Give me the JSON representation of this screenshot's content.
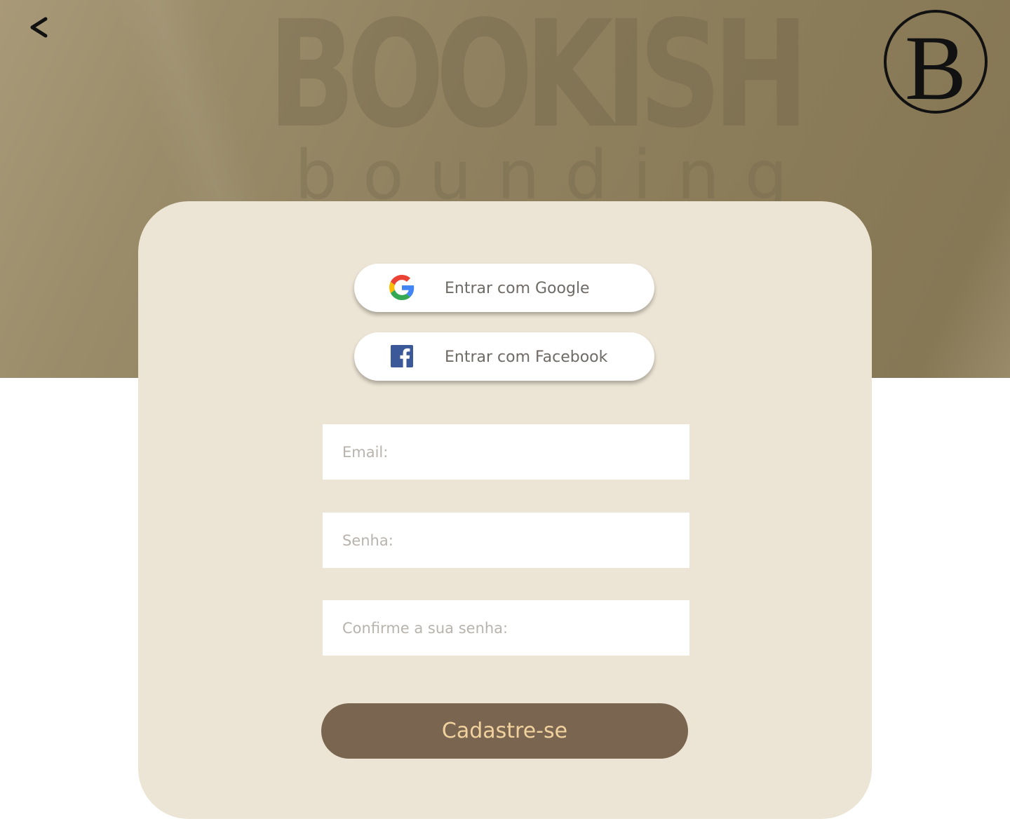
{
  "hero": {
    "watermark_title": "BOOKISH",
    "watermark_subtitle": "bounding"
  },
  "nav": {
    "back_label": "<",
    "logo_letter": "B"
  },
  "social": {
    "google_label": "Entrar com Google",
    "facebook_label": "Entrar com Facebook"
  },
  "form": {
    "email_placeholder": "Email:",
    "email_value": "",
    "password_placeholder": "Senha:",
    "password_value": "",
    "confirm_placeholder": "Confirme a sua senha:",
    "confirm_value": "",
    "submit_label": "Cadastre-se"
  },
  "icons": {
    "back": "chevron-left-icon",
    "logo": "monogram-b-logo",
    "google": "google-g-icon",
    "facebook": "facebook-f-icon"
  },
  "colors": {
    "hero_background": "#8f815f",
    "card_background": "#ece4d4",
    "submit_background": "#7a6650",
    "submit_text": "#f1d29e",
    "social_text": "#6e6a66",
    "placeholder_text": "#b8b3ad",
    "google_blue": "#4285F4",
    "google_red": "#EA4335",
    "google_yellow": "#FBBC05",
    "google_green": "#34A853",
    "facebook_blue": "#3b5998"
  }
}
